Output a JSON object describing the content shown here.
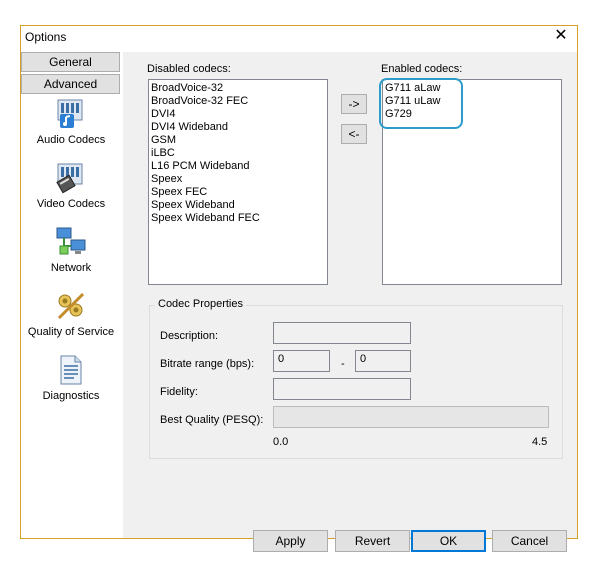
{
  "window": {
    "title": "Options"
  },
  "sidebar": {
    "tabs": [
      {
        "label": "General"
      },
      {
        "label": "Advanced"
      }
    ],
    "items": [
      {
        "label": "Audio Codecs",
        "icon": "audio-codecs-icon"
      },
      {
        "label": "Video Codecs",
        "icon": "video-codecs-icon"
      },
      {
        "label": "Network",
        "icon": "network-icon"
      },
      {
        "label": "Quality of Service",
        "icon": "quality-of-service-icon"
      },
      {
        "label": "Diagnostics",
        "icon": "diagnostics-icon"
      }
    ]
  },
  "codecs": {
    "disabled_label": "Disabled codecs:",
    "enabled_label": "Enabled codecs:",
    "disabled": [
      "BroadVoice-32",
      "BroadVoice-32 FEC",
      "DVI4",
      "DVI4 Wideband",
      "GSM",
      "iLBC",
      "L16 PCM Wideband",
      "Speex",
      "Speex FEC",
      "Speex Wideband",
      "Speex Wideband FEC"
    ],
    "enabled": [
      "G711 aLaw",
      "G711 uLaw",
      "G729"
    ],
    "add_label": "->",
    "remove_label": "<-"
  },
  "properties": {
    "title": "Codec Properties",
    "description_label": "Description:",
    "description_value": "",
    "bitrate_label": "Bitrate range (bps):",
    "bitrate_min": "0",
    "bitrate_sep": "-",
    "bitrate_max": "0",
    "fidelity_label": "Fidelity:",
    "fidelity_value": "",
    "pesq_label": "Best Quality (PESQ):",
    "pesq_min": "0.0",
    "pesq_max": "4.5"
  },
  "buttons": {
    "apply": "Apply",
    "revert": "Revert",
    "ok": "OK",
    "cancel": "Cancel"
  },
  "colors": {
    "highlight": "#2d9cca",
    "window_border": "#d6a12b"
  }
}
